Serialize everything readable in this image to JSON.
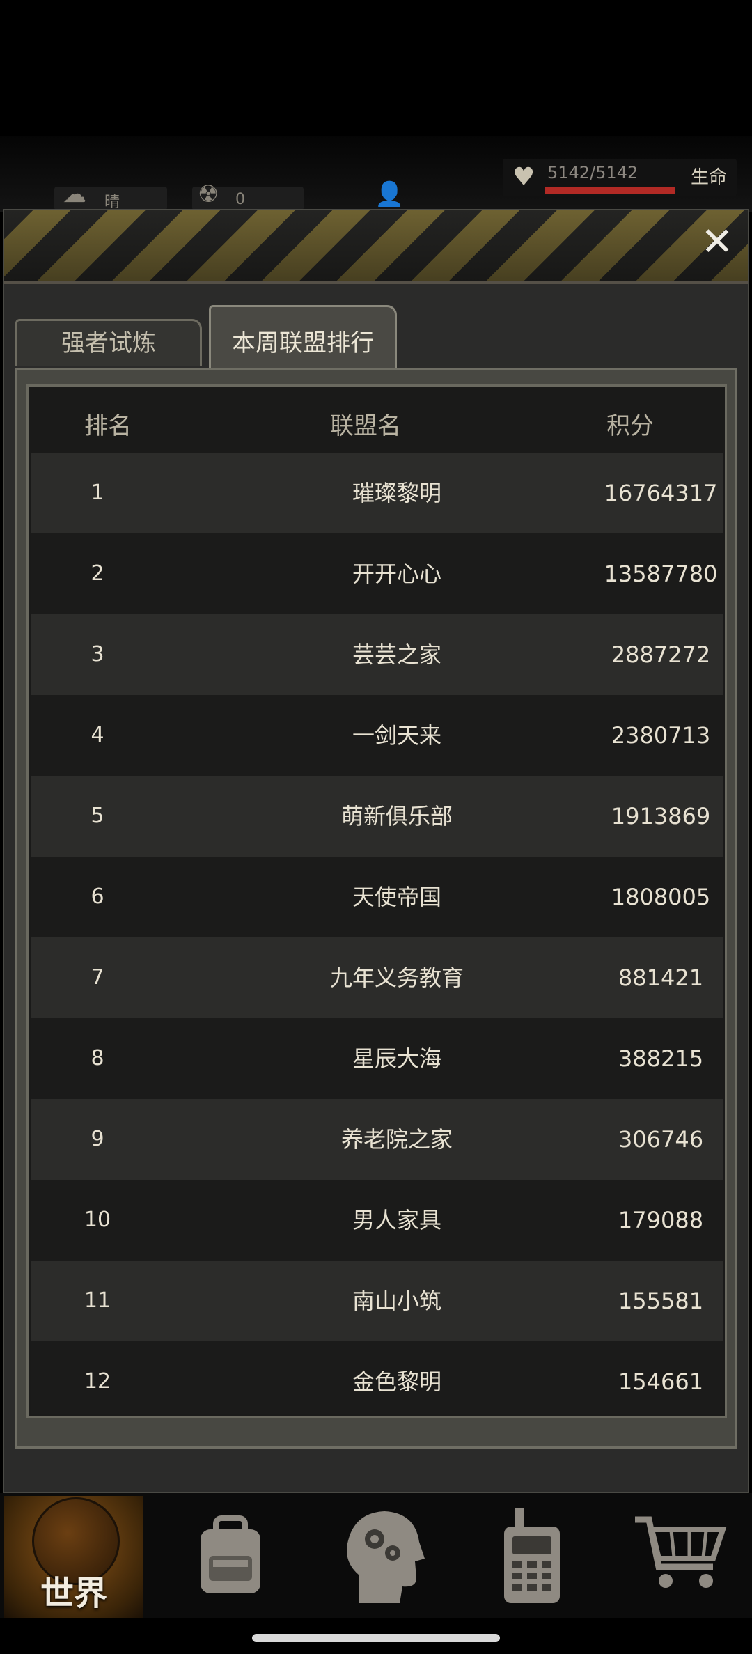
{
  "status": {
    "weather_label": "晴",
    "radiation_value": "0",
    "hp_text": "5142/5142",
    "hp_label": "生命",
    "hp_fraction": 1.0
  },
  "window": {
    "close_symbol": "✕",
    "tabs": [
      {
        "label": "强者试炼",
        "active": false
      },
      {
        "label": "本周联盟排行",
        "active": true
      }
    ]
  },
  "table": {
    "headers": {
      "rank": "排名",
      "name": "联盟名",
      "score": "积分"
    },
    "rows": [
      {
        "rank": "1",
        "name": "璀璨黎明",
        "score": "16764317"
      },
      {
        "rank": "2",
        "name": "开开心心",
        "score": "13587780"
      },
      {
        "rank": "3",
        "name": "芸芸之家",
        "score": "2887272"
      },
      {
        "rank": "4",
        "name": "一剑天来",
        "score": "2380713"
      },
      {
        "rank": "5",
        "name": "萌新俱乐部",
        "score": "1913869"
      },
      {
        "rank": "6",
        "name": "天使帝国",
        "score": "1808005"
      },
      {
        "rank": "7",
        "name": "九年义务教育",
        "score": "881421"
      },
      {
        "rank": "8",
        "name": "星辰大海",
        "score": "388215"
      },
      {
        "rank": "9",
        "name": "养老院之家",
        "score": "306746"
      },
      {
        "rank": "10",
        "name": "男人家具",
        "score": "179088"
      },
      {
        "rank": "11",
        "name": "南山小筑",
        "score": "155581"
      },
      {
        "rank": "12",
        "name": "金色黎明",
        "score": "154661"
      }
    ]
  },
  "nav": {
    "world_label": "世界",
    "icons": [
      "globe-icon",
      "backpack-icon",
      "brain-gears-icon",
      "walkie-talkie-icon",
      "shopping-cart-icon"
    ]
  }
}
